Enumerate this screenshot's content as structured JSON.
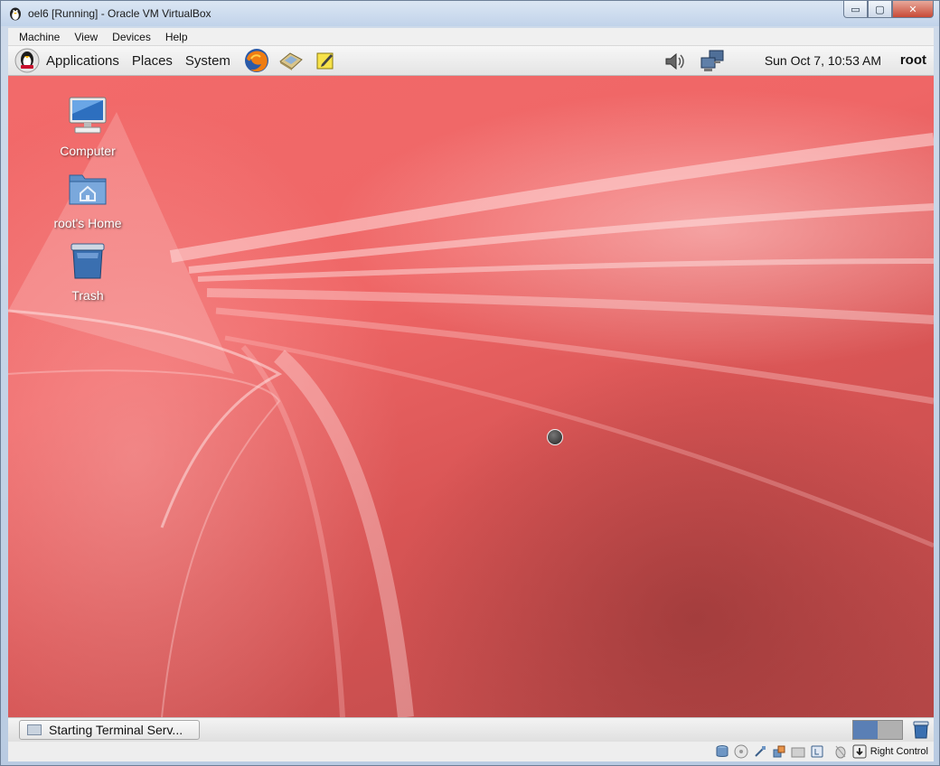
{
  "window": {
    "title": "oel6 [Running] - Oracle VM VirtualBox",
    "controls": {
      "minimize": "▭",
      "maximize": "▢",
      "close": "✕"
    }
  },
  "menu": [
    "Machine",
    "View",
    "Devices",
    "Help"
  ],
  "gnome_panel": {
    "menus": [
      "Applications",
      "Places",
      "System"
    ],
    "launchers": [
      "firefox-icon",
      "mail-icon",
      "notes-icon"
    ],
    "tray_icons": [
      "volume-icon",
      "network-icon"
    ],
    "clock": "Sun Oct  7, 10:53 AM",
    "user": "root"
  },
  "desktop": {
    "icons": [
      {
        "label": "Computer",
        "icon": "computer-icon"
      },
      {
        "label": "root's Home",
        "icon": "home-folder-icon"
      },
      {
        "label": "Trash",
        "icon": "trash-icon"
      }
    ],
    "background_color": "#ef6666"
  },
  "taskbar": {
    "task_label": "Starting Terminal Serv...",
    "workspaces": [
      {
        "active": true
      },
      {
        "active": false
      }
    ]
  },
  "status_bar": {
    "icons": [
      "hard-disk-icon",
      "optical-drive-icon",
      "usb-icon",
      "network-adapter-icon",
      "shared-folders-icon",
      "capture-icon",
      "mouse-integration-icon",
      "host-key-icon"
    ],
    "host_key_label": "Right Control"
  }
}
